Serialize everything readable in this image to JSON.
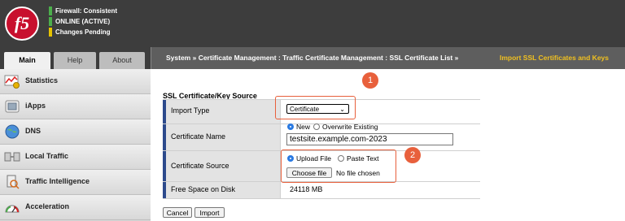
{
  "header": {
    "logo_text": "f5",
    "status": [
      {
        "text": "Firewall: Consistent",
        "color": "#4cae4c"
      },
      {
        "text": "ONLINE (ACTIVE)",
        "color": "#4cae4c"
      },
      {
        "text": "Changes Pending",
        "color": "#e6c200"
      }
    ]
  },
  "tabs": [
    {
      "label": "Main",
      "active": true
    },
    {
      "label": "Help",
      "active": false
    },
    {
      "label": "About",
      "active": false
    }
  ],
  "breadcrumb": {
    "path": "System  »  Certificate Management : Traffic Certificate Management : SSL Certificate List  »",
    "current": "Import SSL Certificates and Keys",
    "path_color": "#ffffff",
    "current_color": "#f0c020"
  },
  "sidebar": {
    "items": [
      {
        "label": "Statistics",
        "icon": "statistics-icon"
      },
      {
        "label": "iApps",
        "icon": "iapps-icon"
      },
      {
        "label": "DNS",
        "icon": "dns-icon"
      },
      {
        "label": "Local Traffic",
        "icon": "local-traffic-icon"
      },
      {
        "label": "Traffic Intelligence",
        "icon": "traffic-intelligence-icon"
      },
      {
        "label": "Acceleration",
        "icon": "acceleration-icon"
      }
    ]
  },
  "form": {
    "section_title": "SSL Certificate/Key Source",
    "import_type": {
      "label": "Import Type",
      "value": "Certificate"
    },
    "certificate_name": {
      "label": "Certificate Name",
      "option_new": "New",
      "option_overwrite": "Overwrite Existing",
      "value": "testsite.example.com-2023"
    },
    "certificate_source": {
      "label": "Certificate Source",
      "option_upload": "Upload File",
      "option_paste": "Paste Text",
      "choose_file_label": "Choose file",
      "no_file_text": "No file chosen"
    },
    "free_space": {
      "label": "Free Space on Disk",
      "value": "24118 MB"
    },
    "cancel_label": "Cancel",
    "import_label": "Import"
  },
  "annotations": {
    "badge_1": "1",
    "badge_2": "2",
    "color": "#e8603c"
  }
}
